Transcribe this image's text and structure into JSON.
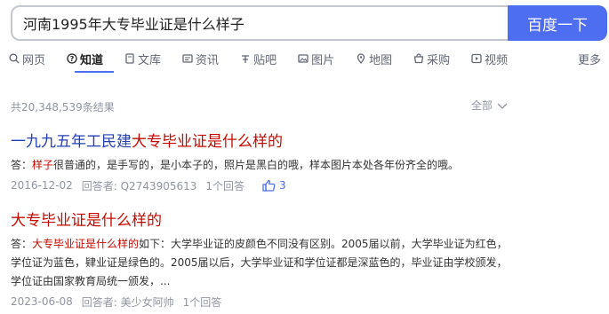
{
  "search": {
    "query": "河南1995年大专毕业证是什么样子",
    "button_label": "百度一下"
  },
  "tabs": [
    {
      "label": "网页",
      "icon": "search-icon"
    },
    {
      "label": "知道",
      "icon": "question-icon",
      "active": true
    },
    {
      "label": "文库",
      "icon": "document-icon"
    },
    {
      "label": "资讯",
      "icon": "news-icon"
    },
    {
      "label": "贴吧",
      "icon": "tieba-icon"
    },
    {
      "label": "图片",
      "icon": "image-icon"
    },
    {
      "label": "地图",
      "icon": "map-pin-icon"
    },
    {
      "label": "采购",
      "icon": "shop-icon"
    },
    {
      "label": "视频",
      "icon": "video-icon"
    },
    {
      "label": "更多"
    }
  ],
  "results_meta": {
    "count_text": "共20,348,539条结果",
    "scope_label": "全部"
  },
  "results": [
    {
      "title_plain": "一九九五年工民建",
      "title_hl": "大专毕业证是什么样的",
      "snippet_prefix": "答：",
      "snippet_hl": "样子",
      "snippet_rest": "很普通的，是手写的，是小本子的，照片是黑白的哦，样本图片本处各年份齐全的哦。",
      "date": "2016-12-02",
      "answerer": "回答者: Q2743905613",
      "answers": "1个回答",
      "likes": "3"
    },
    {
      "title_plain": "",
      "title_hl": "大专毕业证是什么样的",
      "snippet_prefix": "答：",
      "snippet_hl": "大专毕业证是什么样的",
      "snippet_rest": "如下：大学毕业证的皮颜色不同没有区别。2005届以前，大学毕业证为红色，学位证为蓝色，肄业证是绿色的。2005届以后，大学毕业证和学位证都是深蓝色的，毕业证由学校颁发，学位证由国家教育局统一颁发，...",
      "date": "2023-06-08",
      "answerer": "回答者: 美少女阿帅",
      "answers": "1个回答"
    }
  ],
  "colors": {
    "accent": "#4e6ef2",
    "link": "#2440b3",
    "highlight": "#c60a00",
    "muted": "#9195a3"
  }
}
